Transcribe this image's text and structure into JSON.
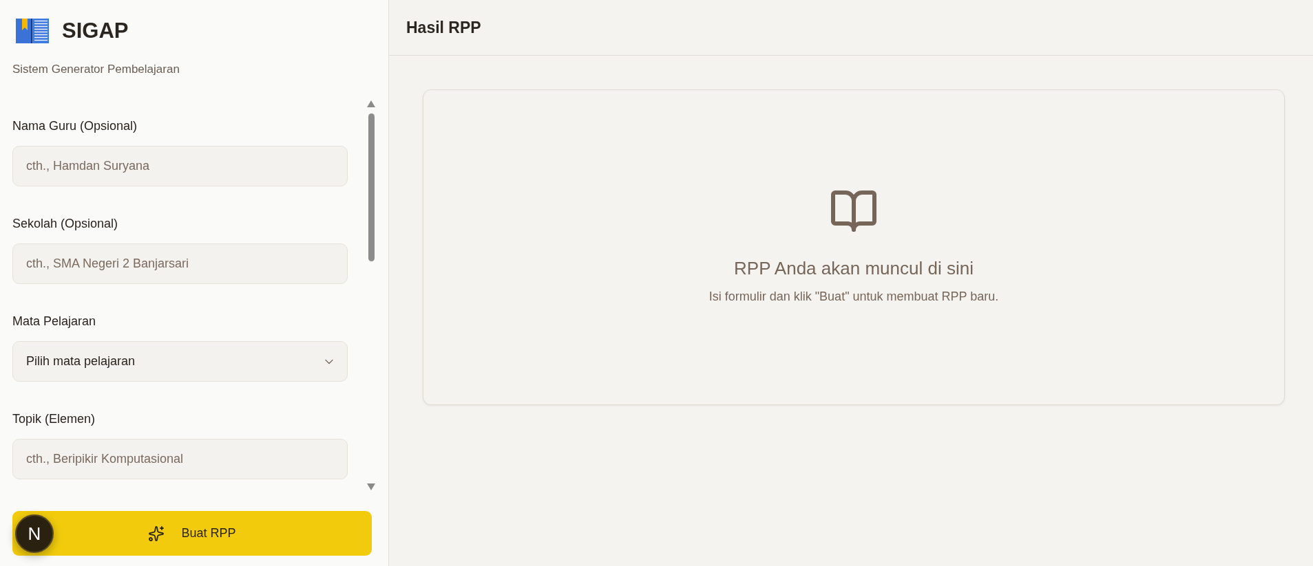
{
  "sidebar": {
    "app_name": "SIGAP",
    "tagline": "Sistem Generator Pembelajaran",
    "fields": [
      {
        "kind": "input",
        "label": "Nama Guru (Opsional)",
        "placeholder": "cth., Hamdan Suryana"
      },
      {
        "kind": "input",
        "label": "Sekolah (Opsional)",
        "placeholder": "cth., SMA Negeri 2 Banjarsari"
      },
      {
        "kind": "select",
        "label": "Mata Pelajaran",
        "value": "Pilih mata pelajaran"
      },
      {
        "kind": "input",
        "label": "Topik (Elemen)",
        "placeholder": "cth., Beripikir Komputasional"
      }
    ],
    "submit_button": "Buat RPP"
  },
  "dev_tools_button": {
    "label": "N"
  },
  "main": {
    "title": "Hasil RPP",
    "empty_state": {
      "title": "RPP Anda akan muncul di sini",
      "message": "Isi formulir dan klik \"Buat\" untuk membuat RPP baru."
    }
  }
}
